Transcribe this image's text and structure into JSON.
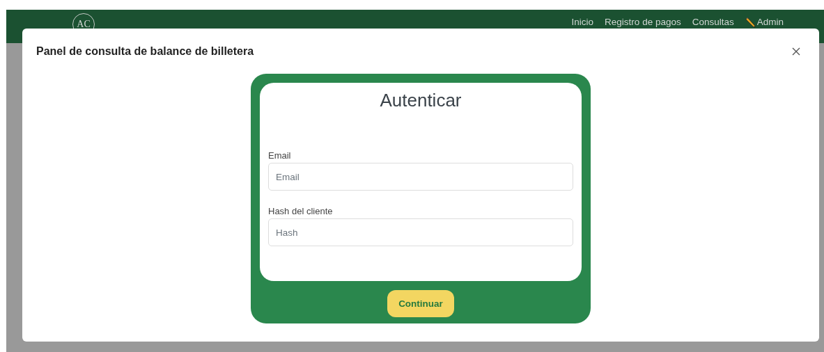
{
  "navbar": {
    "logo": "AC",
    "links": [
      {
        "label": "Inicio",
        "kind": "text"
      },
      {
        "label": "Registro de pagos",
        "kind": "text"
      },
      {
        "label": "Consultas",
        "kind": "text"
      },
      {
        "label": "Admin",
        "kind": "pencil"
      }
    ]
  },
  "modal": {
    "title": "Panel de consulta de balance de billetera",
    "form": {
      "heading": "Autenticar",
      "fields": [
        {
          "label": "Email",
          "placeholder": "Email"
        },
        {
          "label": "Hash del cliente",
          "placeholder": "Hash"
        }
      ],
      "button": "Continuar"
    }
  }
}
